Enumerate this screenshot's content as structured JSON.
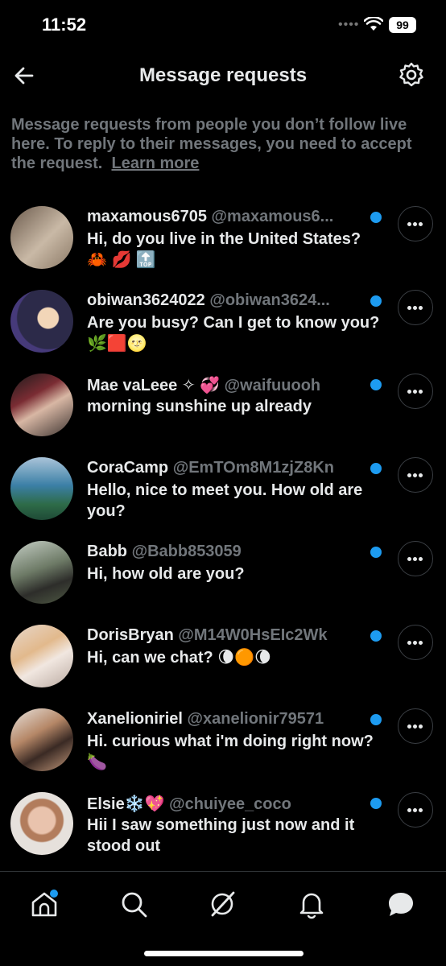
{
  "status": {
    "time": "11:52",
    "battery": "99"
  },
  "header": {
    "title": "Message requests"
  },
  "info": {
    "text": "Message requests from people you don’t follow live here. To reply to their messages, you need to accept the request.",
    "link": "Learn more"
  },
  "requests": [
    {
      "name": "maxamous6705",
      "handle": "@maxamous6...",
      "message": "Hi, do you live in the United States?",
      "extra": "🦀 💋 🔝"
    },
    {
      "name": "obiwan3624022",
      "handle": "@obiwan3624...",
      "message": "Are you busy? Can I get to know you? 🌿🟥🌝"
    },
    {
      "name": "Mae vaLeee ✧ 💞",
      "handle": "@waifuuooh",
      "message": "morning sunshine up already"
    },
    {
      "name": "CoraCamp",
      "handle": "@EmTOm8M1zjZ8Kn",
      "message": "Hello, nice to meet you. How old are you?"
    },
    {
      "name": "Babb",
      "handle": "@Babb853059",
      "message": "Hi, how old are you?"
    },
    {
      "name": "DorisBryan",
      "handle": "@M14W0HsEIc2Wk",
      "message": "Hi, can we chat? 🌘🟠🌘"
    },
    {
      "name": "Xanelioniriel",
      "handle": "@xanelionir79571",
      "message": "Hi. curious what i'm doing right now? 🍆"
    },
    {
      "name": "Elsie❄️💖",
      "handle": "@chuiyee_coco",
      "message": "Hii I saw something just now and it stood out"
    }
  ],
  "colors": {
    "accent": "#1d9bf0",
    "background": "#000000",
    "muted": "#71767b"
  }
}
